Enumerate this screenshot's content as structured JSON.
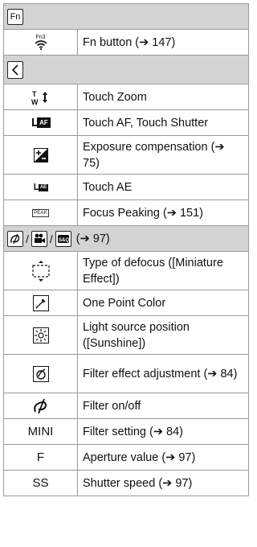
{
  "fn_header": {
    "icon_label": "Fn"
  },
  "fn_row": {
    "icon_label": "Fn3",
    "text": "Fn button (➔ 147)"
  },
  "touch_rows": [
    {
      "icon": "touch-zoom-icon",
      "text": "Touch Zoom"
    },
    {
      "icon": "touch-af-icon",
      "icon_label": "AF",
      "text": "Touch AF, Touch Shutter"
    },
    {
      "icon": "exposure-compensation-icon",
      "text": "Exposure compensation (➔ 75)"
    },
    {
      "icon": "touch-ae-icon",
      "icon_label": "AE",
      "text": "Touch AE"
    },
    {
      "icon": "peaking-icon",
      "icon_label": "PEAK",
      "text": "Focus Peaking (➔ 151)"
    }
  ],
  "mode_header": {
    "slash": "/",
    "text": "(➔ 97)"
  },
  "mode_rows": [
    {
      "icon": "defocus-frame-icon",
      "text": "Type of defocus ([Miniature Effect])"
    },
    {
      "icon": "one-point-color-icon",
      "text": "One Point Color"
    },
    {
      "icon": "light-source-icon",
      "text": "Light source position ([Sunshine])"
    },
    {
      "icon": "filter-adjust-icon",
      "text": "Filter effect adjustment (➔ 84)"
    },
    {
      "icon": "filter-onoff-icon",
      "text": "Filter on/off"
    },
    {
      "icon_text": "MINI",
      "text": "Filter setting (➔ 84)"
    },
    {
      "icon_text": "F",
      "text": "Aperture value (➔ 97)"
    },
    {
      "icon_text": "SS",
      "text": "Shutter speed (➔ 97)"
    }
  ]
}
